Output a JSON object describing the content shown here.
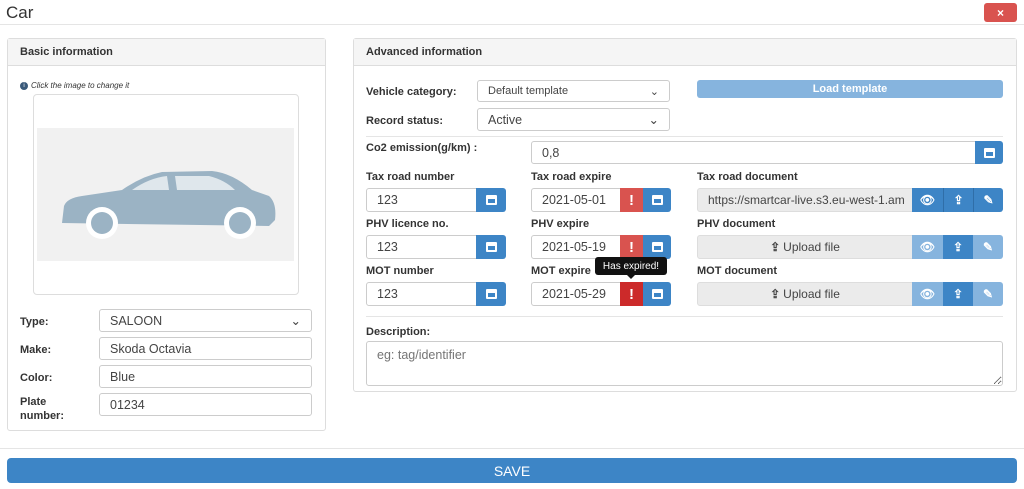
{
  "window": {
    "title": "Car",
    "close_label": "×"
  },
  "basic": {
    "header": "Basic information",
    "hint": "Click the image to change it",
    "type_label": "Type:",
    "type_value": "SALOON",
    "make_label": "Make:",
    "make_value": "Skoda Octavia",
    "color_label": "Color:",
    "color_value": "Blue",
    "plate_label": "Plate number:",
    "plate_value": "01234"
  },
  "advanced": {
    "header": "Advanced information",
    "vehicle_category_label": "Vehicle category:",
    "vehicle_category_value": "Default template",
    "load_template_label": "Load template",
    "record_status_label": "Record status:",
    "record_status_value": "Active",
    "co2_label": "Co2 emission(g/km) :",
    "co2_value": "0,8",
    "rows": [
      {
        "number_label": "Tax road number",
        "number_value": "123",
        "expire_label": "Tax road expire",
        "expire_value": "2021-05-01",
        "doc_label": "Tax road document",
        "doc_value": "https://smartcar-live.s3.eu-west-1.am"
      },
      {
        "number_label": "PHV licence no.",
        "number_value": "123",
        "expire_label": "PHV expire",
        "expire_value": "2021-05-19",
        "doc_label": "PHV document",
        "doc_value": "Upload file"
      },
      {
        "number_label": "MOT number",
        "number_value": "123",
        "expire_label": "MOT expire",
        "expire_value": "2021-05-29",
        "doc_label": "MOT document",
        "doc_value": "Upload file"
      }
    ],
    "tooltip": "Has expired!",
    "expired_mark": "!",
    "description_label": "Description:",
    "description_placeholder": "eg: tag/identifier"
  },
  "footer": {
    "save_label": "SAVE"
  },
  "colors": {
    "primary": "#3d85c6",
    "danger": "#d9534f"
  }
}
